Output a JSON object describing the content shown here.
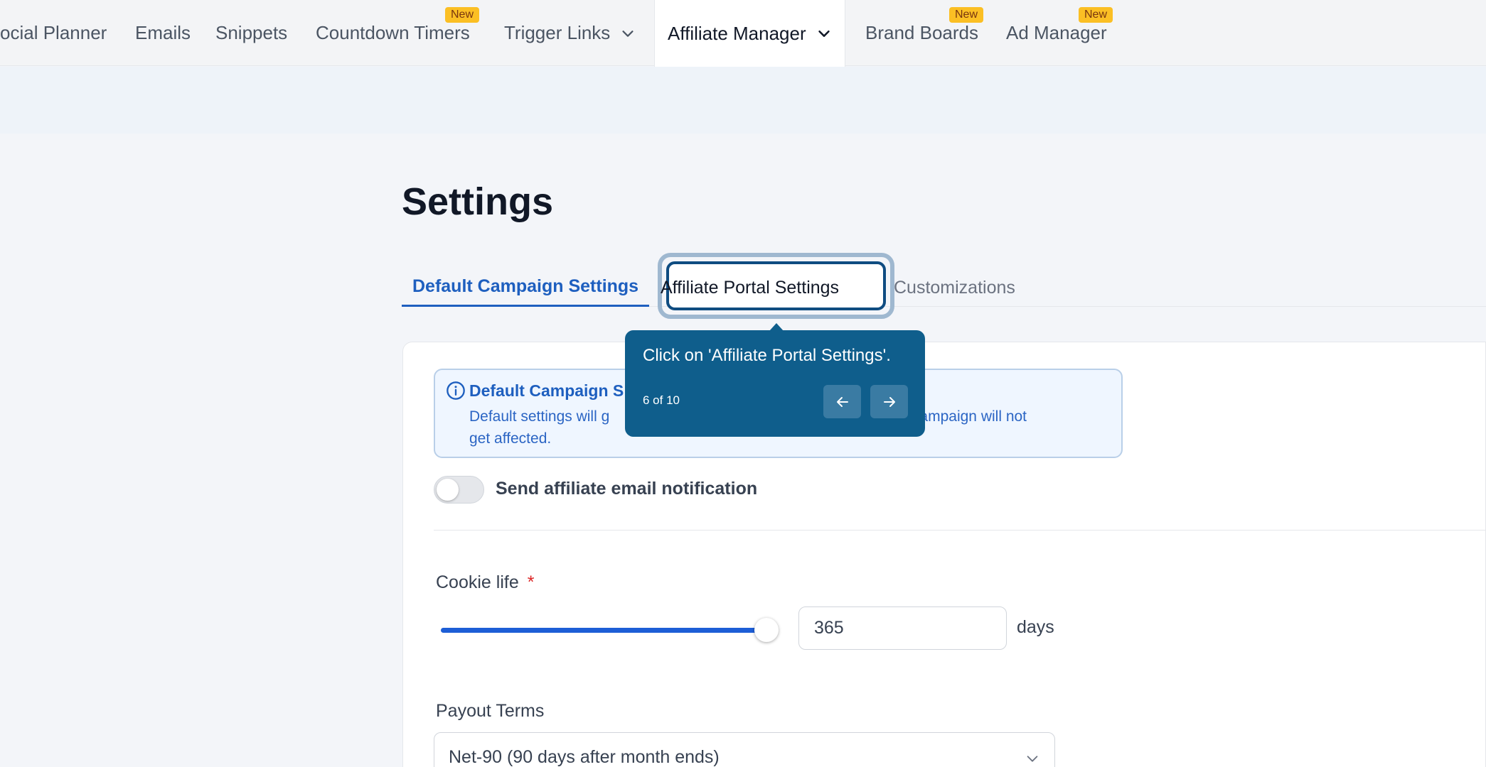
{
  "nav": {
    "items": [
      {
        "label": "ocial Planner"
      },
      {
        "label": "Emails"
      },
      {
        "label": "Snippets"
      },
      {
        "label": "Countdown Timers",
        "badge": "New"
      },
      {
        "label": "Trigger Links"
      },
      {
        "label": "Affiliate Manager"
      },
      {
        "label": "Brand Boards",
        "badge": "New"
      },
      {
        "label": "Ad Manager",
        "badge": "New"
      }
    ],
    "active": "Affiliate Manager"
  },
  "page": {
    "title": "Settings"
  },
  "tabs": [
    {
      "label": "Default Campaign Settings"
    },
    {
      "label": "Affiliate Portal Settings"
    },
    {
      "label": "Customizations"
    }
  ],
  "info": {
    "title": "Default Campaign S",
    "text_line1": "Default settings will g",
    "text_line1_tail": "Campaign will not",
    "text_line2": "get affected."
  },
  "notification_toggle": {
    "label": "Send affiliate email notification",
    "on": false
  },
  "cookie_life": {
    "label": "Cookie life",
    "required_mark": "*",
    "value": "365",
    "unit": "days",
    "slider_fraction": 1.0
  },
  "payout_terms": {
    "label": "Payout Terms",
    "value": "Net-90 (90 days after month ends)"
  },
  "tooltip": {
    "text": "Click on 'Affiliate Portal Settings'.",
    "step": "6 of 10",
    "prev_icon": "arrow-left-icon",
    "next_icon": "arrow-right-icon"
  },
  "colors": {
    "accent": "#1e5fbf",
    "tooltip_bg": "#0f5e8c",
    "badge": "#fbbf24",
    "slider": "#1d5ed6"
  }
}
